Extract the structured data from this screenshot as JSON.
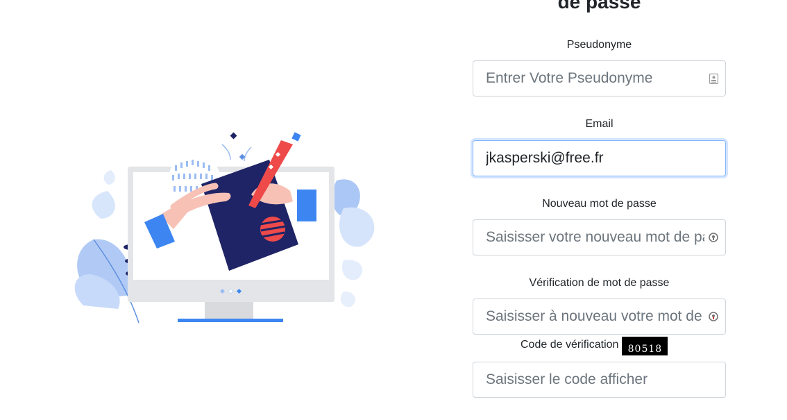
{
  "page": {
    "title": "de passe"
  },
  "form": {
    "pseudonyme": {
      "label": "Pseudonyme",
      "placeholder": "Entrer Votre Pseudonyme",
      "value": "",
      "icon": "contact-card-icon"
    },
    "email": {
      "label": "Email",
      "placeholder": "",
      "value": "jkasperski@free.fr"
    },
    "new_password": {
      "label": "Nouveau mot de passe",
      "placeholder": "Saisisser votre nouveau mot de passe",
      "value": "",
      "icon": "password-key-icon"
    },
    "confirm_password": {
      "label": "Vérification de mot de passe",
      "placeholder": "Saisisser à nouveau votre mot de passe",
      "value": "",
      "icon": "password-key-icon"
    },
    "captcha": {
      "label": "Code de vérification",
      "code": "80518",
      "placeholder": "Saisisser le code afficher",
      "value": ""
    }
  },
  "colors": {
    "accent_blue": "#3d86f2",
    "navy": "#1f2466",
    "accent_red": "#ee4a4a",
    "input_border": "#ced4da",
    "focus_border": "#86b7fe"
  },
  "illustration": {
    "name": "computer-signing-illustration"
  }
}
